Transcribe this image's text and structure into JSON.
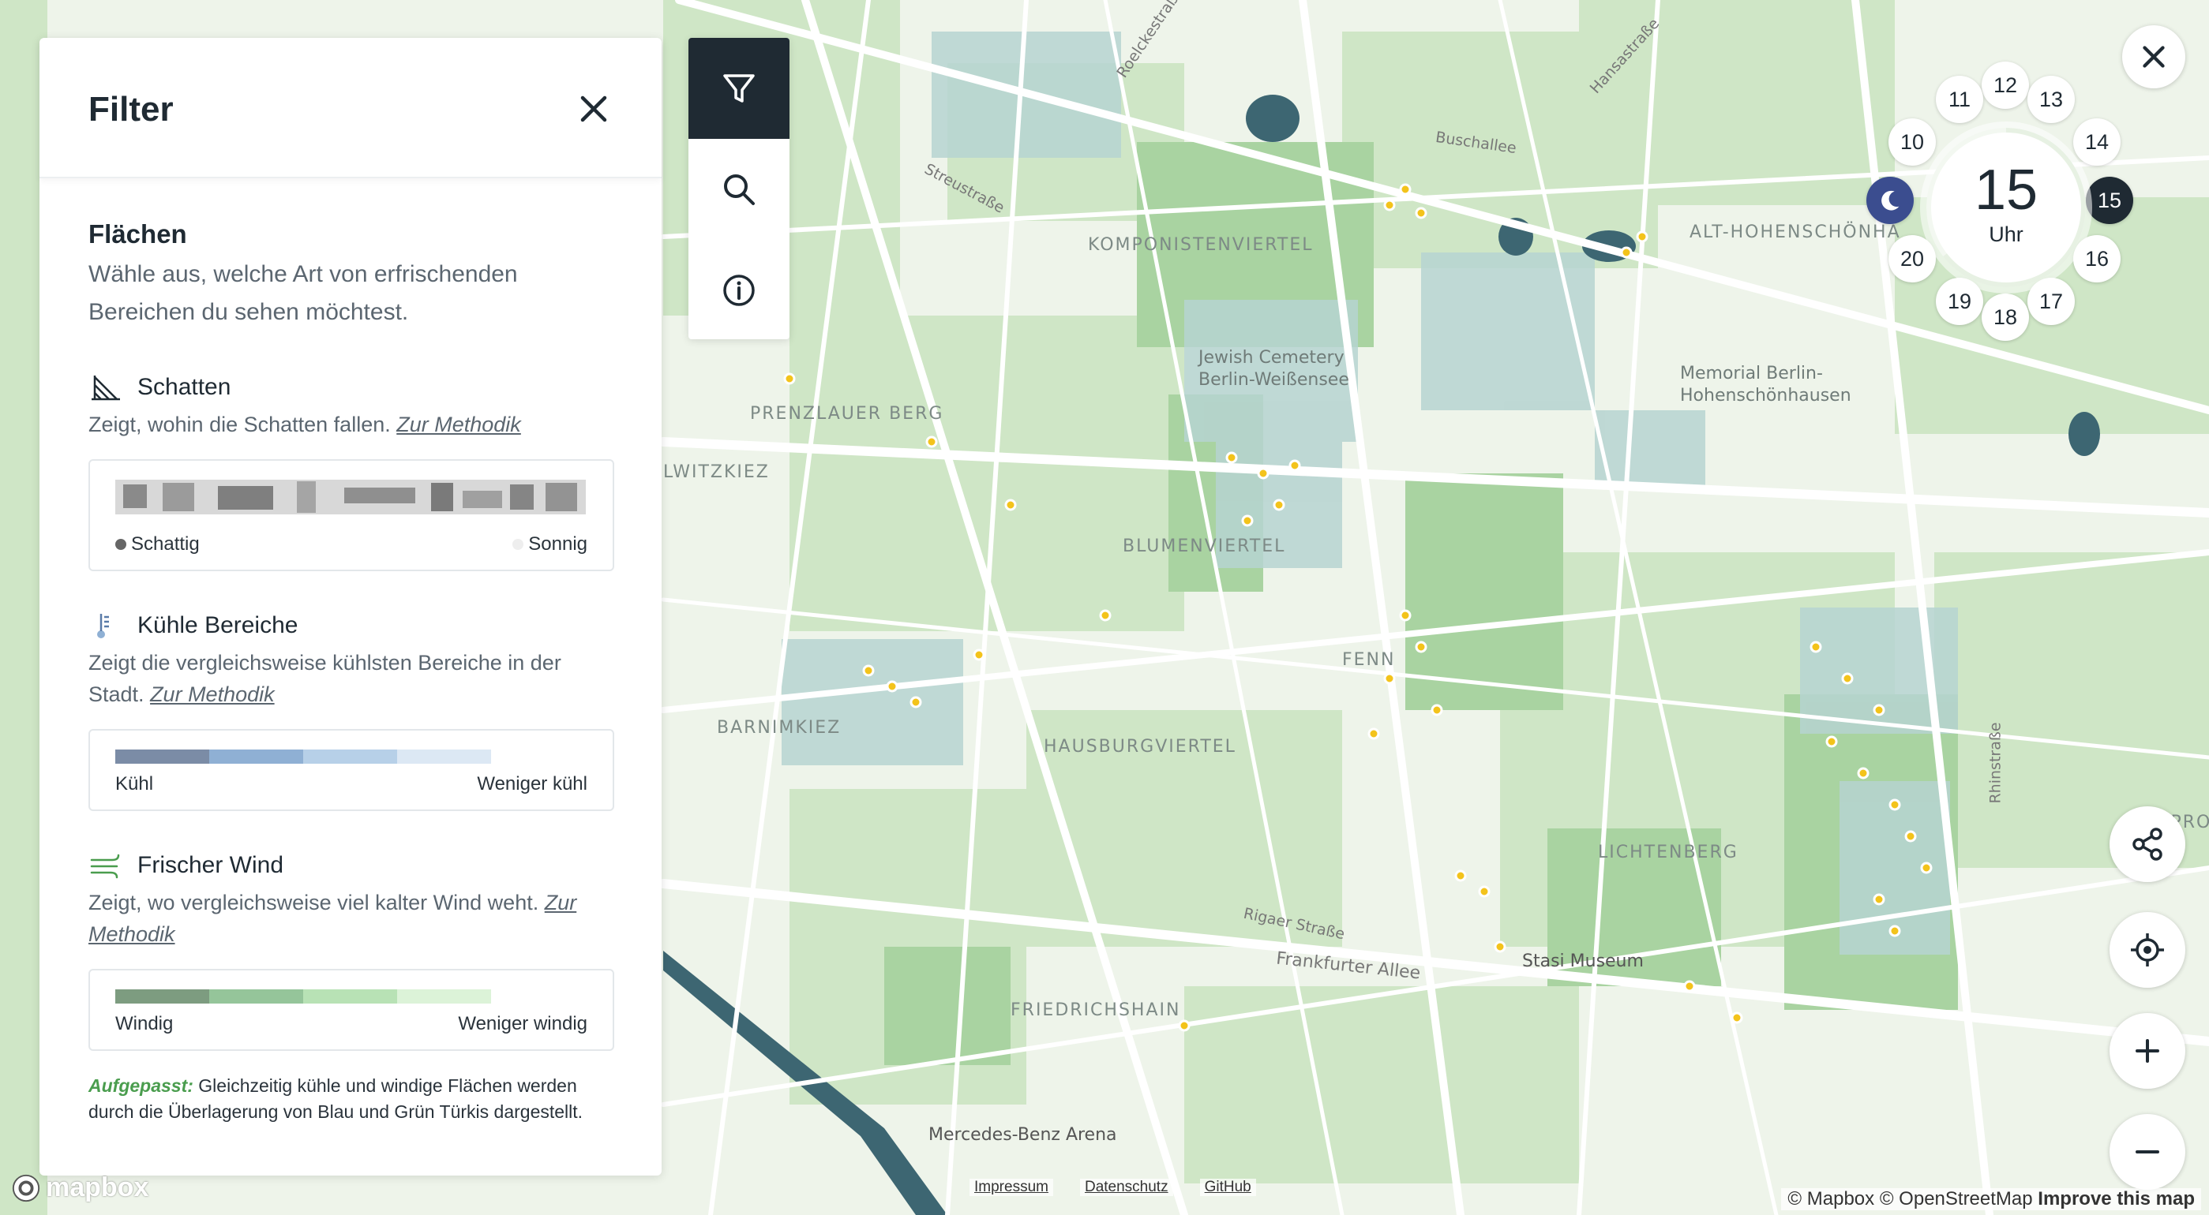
{
  "panel": {
    "title": "Filter",
    "section_title": "Flächen",
    "section_desc": "Wähle aus, welche Art von erfrischenden Bereichen du sehen möchtest.",
    "shadow": {
      "title": "Schatten",
      "desc": "Zeigt, wohin die Schatten fallen.",
      "link": "Zur Methodik",
      "left_label": "Schattig",
      "right_label": "Sonnig"
    },
    "cool": {
      "title": "Kühle Bereiche",
      "desc": "Zeigt die vergleichsweise kühlsten Bereiche in der Stadt.",
      "link": "Zur Methodik",
      "left_label": "Kühl",
      "right_label": "Weniger kühl",
      "colors": [
        "#7b8ca6",
        "#8fb0d4",
        "#b7d0e8",
        "#dce8f4"
      ]
    },
    "wind": {
      "title": "Frischer Wind",
      "desc": "Zeigt, wo vergleichsweise viel kalter Wind weht.",
      "link": "Zur Methodik",
      "left_label": "Windig",
      "right_label": "Weniger windig",
      "colors": [
        "#7d9c80",
        "#95c59a",
        "#b8e2b5",
        "#dcf3d8"
      ]
    },
    "note_label": "Aufgepasst:",
    "note_text": "Gleichzeitig kühle und windige Flächen werden durch die Überlagerung von Blau und Grün Türkis dargestellt."
  },
  "toolbar": {
    "items": [
      "filter-icon",
      "search-icon",
      "info-icon"
    ]
  },
  "clock": {
    "hour": "15",
    "unit": "Uhr",
    "hours": [
      "12",
      "13",
      "14",
      "15",
      "16",
      "17",
      "18",
      "19",
      "20",
      "",
      "10",
      "11"
    ],
    "selected": "15"
  },
  "map": {
    "labels": {
      "komponistenviertel": "KOMPONISTENVIERTEL",
      "prenzlauer_berg": "PRENZLAUER BERG",
      "witzkiez": "LWITZKIEZ",
      "blumenviertel": "BLUMENVIERTEL",
      "barnimkiez": "BARNIMKIEZ",
      "hausburgviertel": "HAUSBURGVIERTEL",
      "fenn": "FENN",
      "friedrichshain": "FRIEDRICHSHAIN",
      "lichtenberg": "LICHTENBERG",
      "alt_hohen": "ALT-HOHENSCHÖNHA",
      "jewish_cemetery": "Jewish Cemetery Berlin-Weißensee",
      "memorial": "Memorial Berlin-Hohenschönhausen",
      "stasi": "Stasi Museum",
      "benz": "Mercedes-Benz Arena",
      "streustrasse": "Streustraße",
      "buschallee": "Buschallee",
      "rigaer": "Rigaer Straße",
      "frankfurter": "Frankfurter Allee",
      "rhinstrasse": "Rhinstraße",
      "roelckestrasse": "Roelckestraße",
      "hansastrasse": "Hansastraße",
      "improve": "IMPROVE"
    }
  },
  "footer": {
    "links": [
      "Impressum",
      "Datenschutz",
      "GitHub"
    ],
    "attribution": "© Mapbox © OpenStreetMap",
    "improve": "Improve this map",
    "logo": "mapbox"
  }
}
